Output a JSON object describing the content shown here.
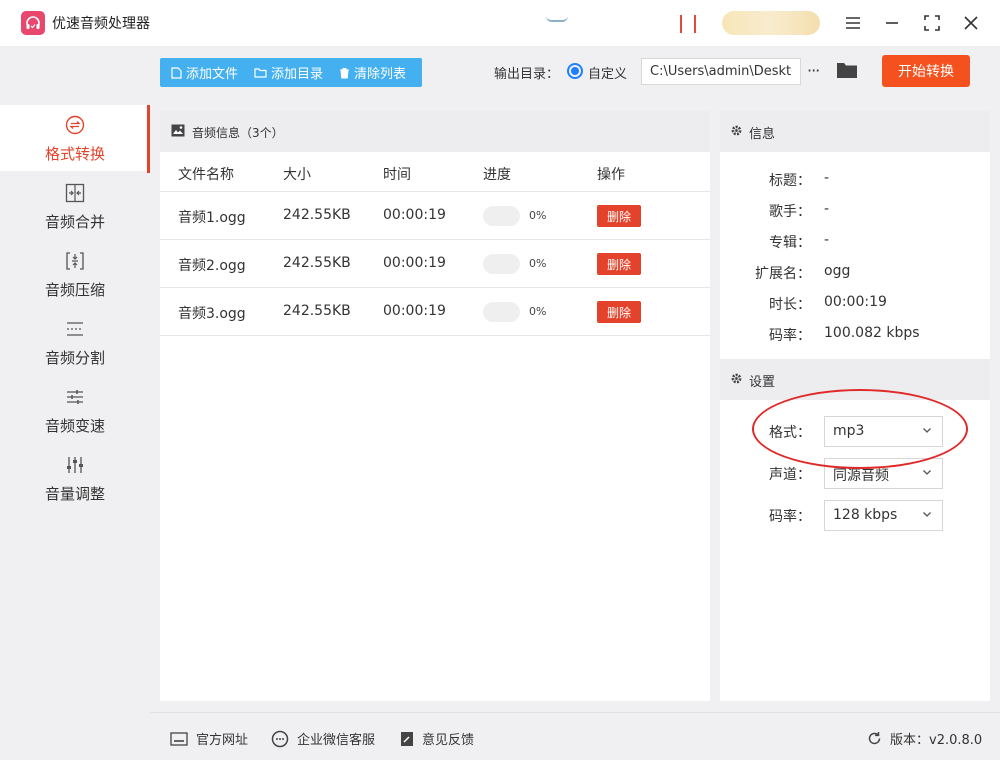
{
  "app": {
    "title": "优速音频处理器",
    "logo_icon": "headphones-icon"
  },
  "window": {
    "menu_icon": "hamburger-menu-icon",
    "minimize_icon": "minimize-icon",
    "maximize_icon": "maximize-icon",
    "close_icon": "close-icon"
  },
  "sidebar": {
    "items": [
      {
        "label": "格式转换",
        "icon": "format-convert-icon",
        "active": true
      },
      {
        "label": "音频合并",
        "icon": "merge-icon",
        "active": false
      },
      {
        "label": "音频压缩",
        "icon": "compress-icon",
        "active": false
      },
      {
        "label": "音频分割",
        "icon": "split-icon",
        "active": false
      },
      {
        "label": "音频变速",
        "icon": "speed-icon",
        "active": false
      },
      {
        "label": "音量调整",
        "icon": "volume-adjust-icon",
        "active": false
      }
    ]
  },
  "toolbar": {
    "add_file": "添加文件",
    "add_dir": "添加目录",
    "clear_list": "清除列表",
    "output_label": "输出目录：",
    "custom_label": "自定义",
    "output_path": "C:\\Users\\admin\\Desktop",
    "more": "···",
    "start": "开始转换"
  },
  "file_panel": {
    "title": "音频信息（3个）",
    "columns": {
      "name": "文件名称",
      "size": "大小",
      "time": "时间",
      "progress": "进度",
      "action": "操作"
    },
    "rows": [
      {
        "name": "音频1.ogg",
        "size": "242.55KB",
        "time": "00:00:19",
        "progress": 0,
        "progress_text": "0%",
        "delete": "删除"
      },
      {
        "name": "音频2.ogg",
        "size": "242.55KB",
        "time": "00:00:19",
        "progress": 0,
        "progress_text": "0%",
        "delete": "删除"
      },
      {
        "name": "音频3.ogg",
        "size": "242.55KB",
        "time": "00:00:19",
        "progress": 0,
        "progress_text": "0%",
        "delete": "删除"
      }
    ]
  },
  "info": {
    "title": "信息",
    "fields": [
      {
        "label": "标题：",
        "value": "-"
      },
      {
        "label": "歌手：",
        "value": "-"
      },
      {
        "label": "专辑：",
        "value": "-"
      },
      {
        "label": "扩展名：",
        "value": "ogg"
      },
      {
        "label": "时长：",
        "value": "00:00:19"
      },
      {
        "label": "码率：",
        "value": "100.082 kbps"
      }
    ]
  },
  "settings": {
    "title": "设置",
    "format": {
      "label": "格式：",
      "value": "mp3"
    },
    "channel": {
      "label": "声道：",
      "value": "同源音频"
    },
    "bitrate": {
      "label": "码率：",
      "value": "128 kbps"
    }
  },
  "footer": {
    "website": "官方网址",
    "wechat": "企业微信客服",
    "feedback": "意见反馈",
    "version": "版本：v2.0.8.0"
  },
  "colors": {
    "accent": "#e4432b",
    "toolbar_blue": "#45b0f0",
    "start_button": "#f4511e",
    "radio_blue": "#1e80ff"
  }
}
